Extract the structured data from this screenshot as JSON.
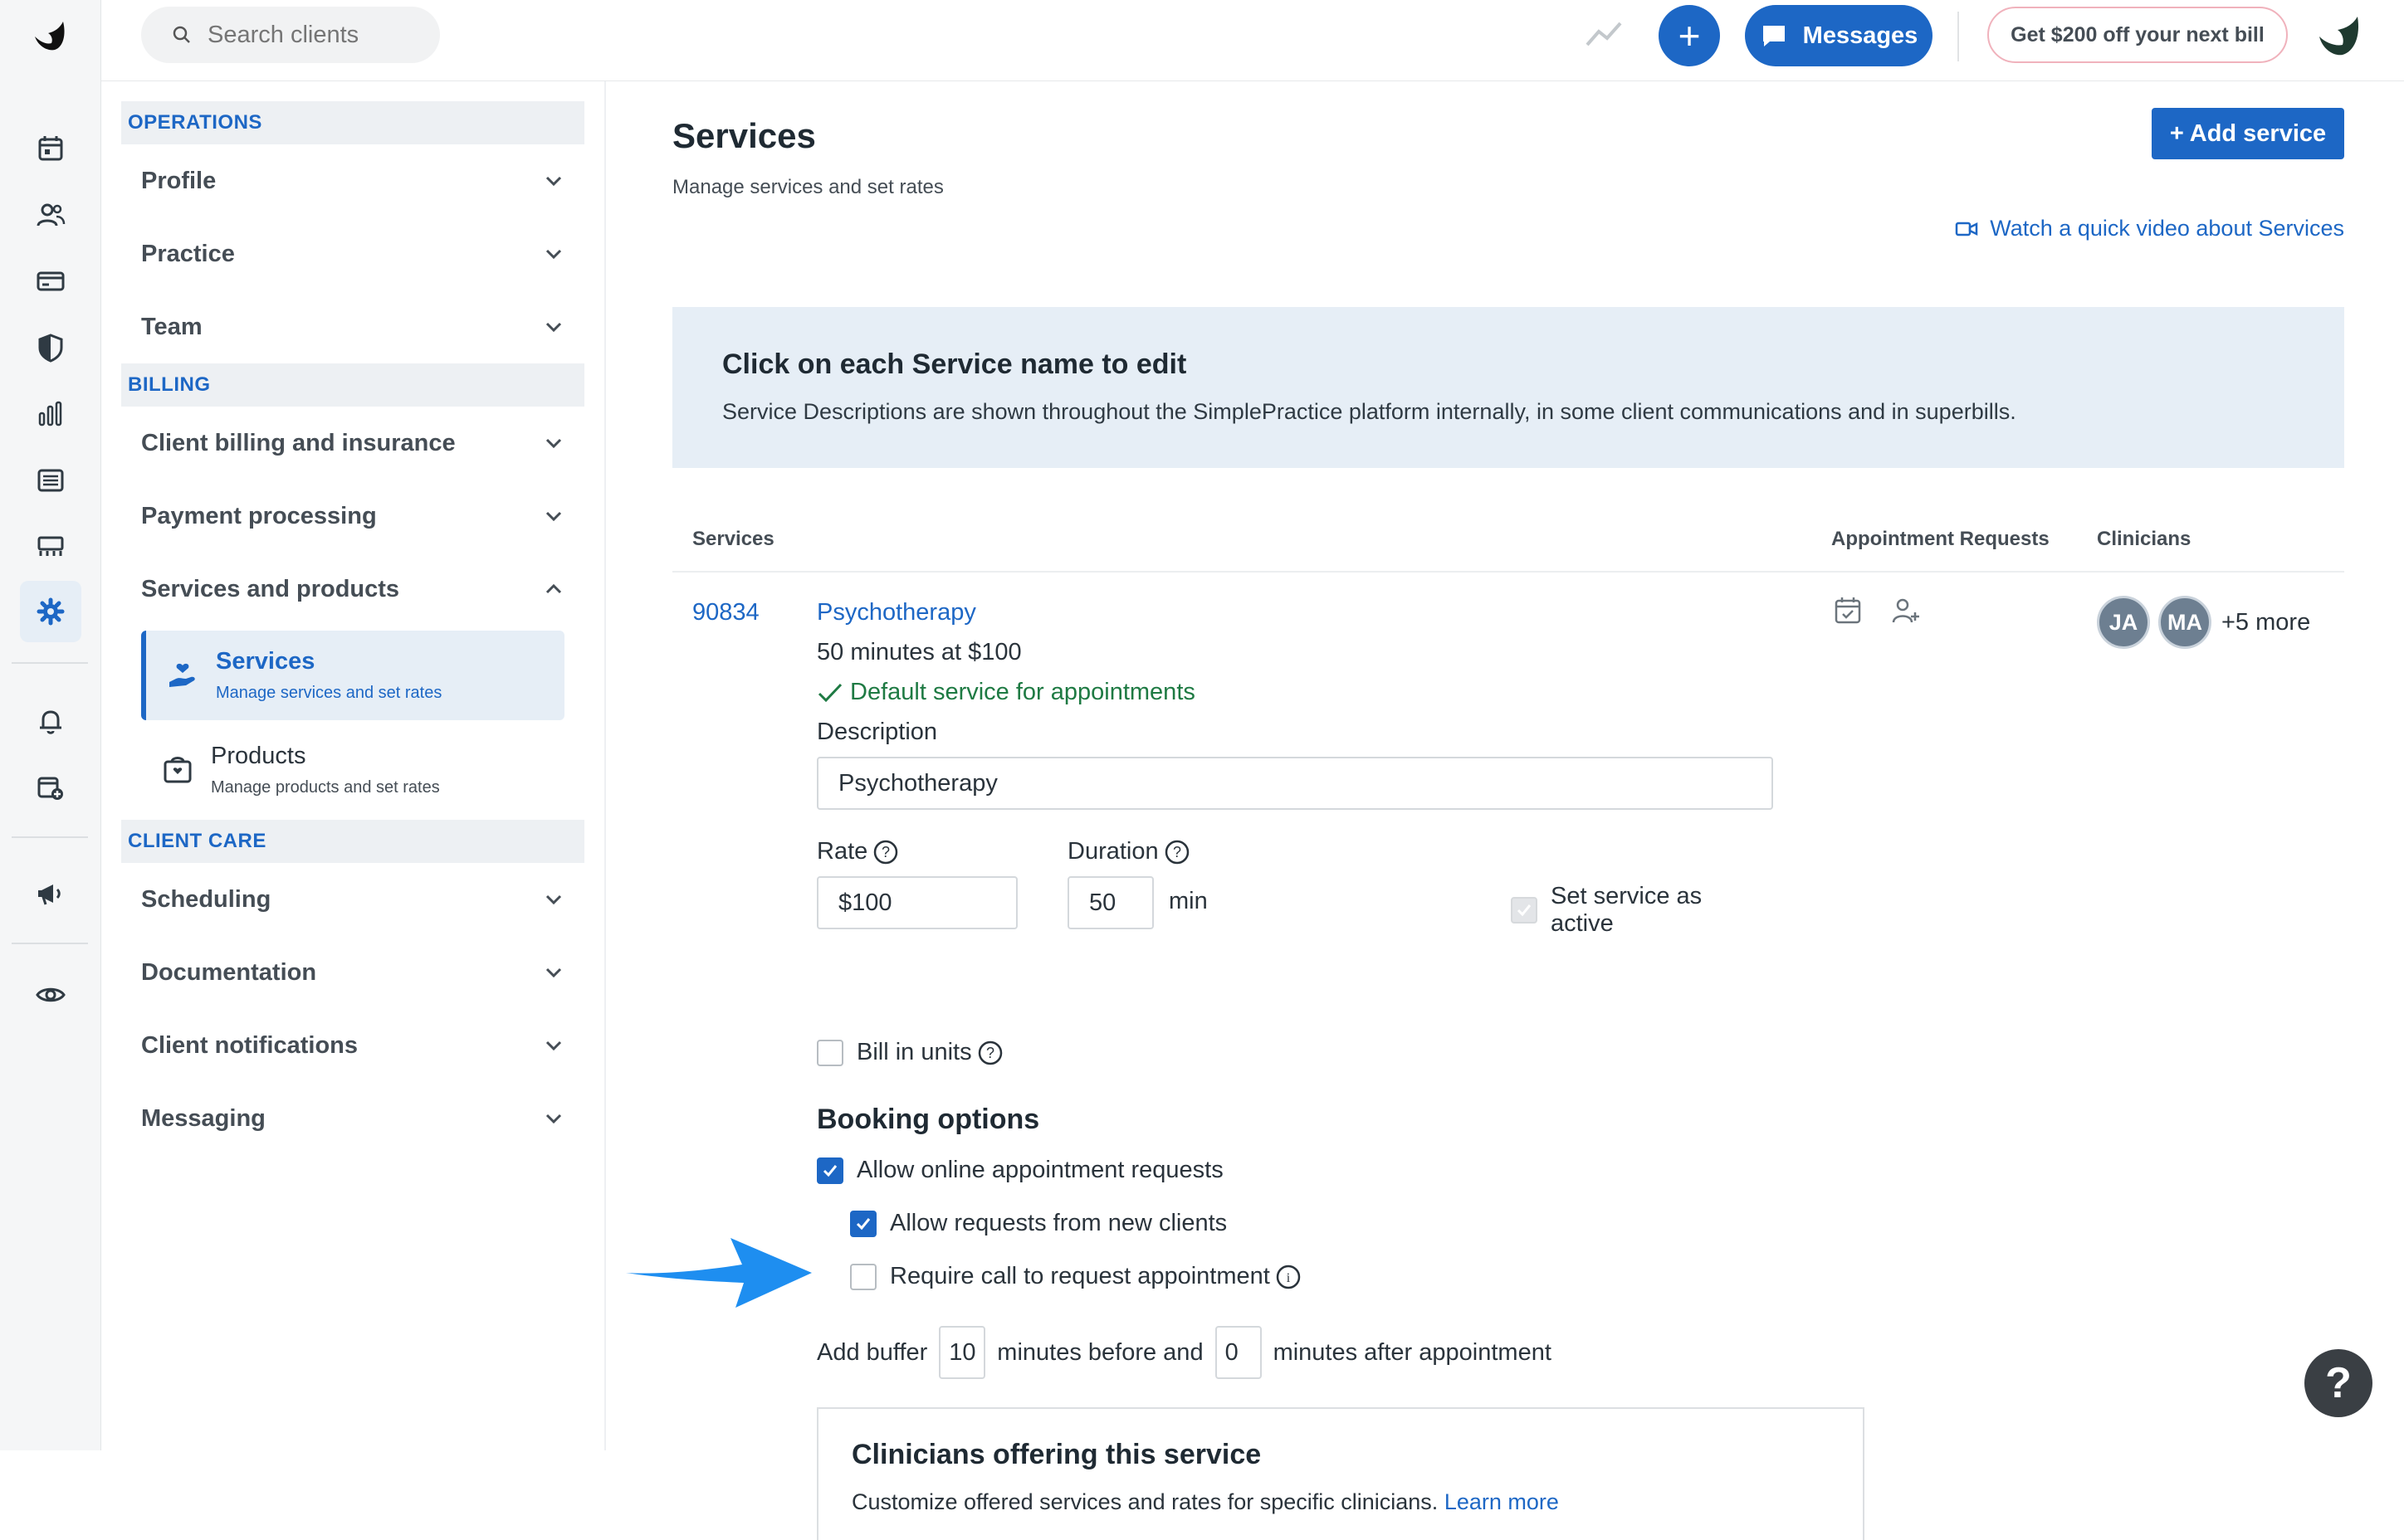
{
  "topbar": {
    "search_placeholder": "Search clients",
    "messages_label": "Messages",
    "promo_label": "Get $200 off your next bill"
  },
  "rail_icons": [
    "calendar-icon",
    "clients-icon",
    "billing-icon",
    "insurance-shield-icon",
    "analytics-icon",
    "documents-icon",
    "marketplace-icon",
    "settings-gear-icon",
    "notifications-bell-icon",
    "requests-calendar-icon",
    "marketing-megaphone-icon",
    "preview-eye-icon"
  ],
  "settings_nav": {
    "operations": {
      "title": "OPERATIONS",
      "items": [
        "Profile",
        "Practice",
        "Team"
      ]
    },
    "billing": {
      "title": "BILLING",
      "items": [
        "Client billing and insurance",
        "Payment processing",
        "Services and products"
      ]
    },
    "sub_items": [
      {
        "title": "Services",
        "subtitle": "Manage services and set rates"
      },
      {
        "title": "Products",
        "subtitle": "Manage products and set rates"
      }
    ],
    "client_care": {
      "title": "CLIENT CARE",
      "items": [
        "Scheduling",
        "Documentation",
        "Client notifications",
        "Messaging"
      ]
    }
  },
  "main": {
    "title": "Services",
    "subtitle": "Manage services and set rates",
    "add_service_label": "+ Add service",
    "video_link": "Watch a quick video about Services",
    "info": {
      "heading": "Click on each Service name to edit",
      "text": "Service Descriptions are shown throughout the SimplePractice platform internally, in some client communications and in superbills."
    },
    "columns": {
      "services": "Services",
      "appointment_requests": "Appointment Requests",
      "clinicians": "Clinicians"
    },
    "service": {
      "code": "90834",
      "name": "Psychotherapy",
      "meta": "50 minutes at $100",
      "default_label": "Default service for appointments",
      "description_label": "Description",
      "description_value": "Psychotherapy",
      "rate_label": "Rate",
      "rate_value": "$100",
      "duration_label": "Duration",
      "duration_value": "50",
      "duration_unit": "min",
      "active_label": "Set service as active",
      "bill_units_label": "Bill in units",
      "booking_heading": "Booking options",
      "allow_online": "Allow online appointment requests",
      "allow_new": "Allow requests from new clients",
      "require_call": "Require call to request appointment",
      "buffer": {
        "prefix": "Add buffer",
        "before_value": "10",
        "middle": "minutes before and",
        "after_value": "0",
        "suffix": "minutes after appointment"
      },
      "clinician_avatars": [
        "JA",
        "MA"
      ],
      "more_label": "+5 more"
    },
    "clinicians_box": {
      "heading": "Clinicians offering this service",
      "text": "Customize offered services and rates for specific clinicians.",
      "link": "Learn more"
    }
  },
  "help_label": "?",
  "colors": {
    "accent": "#1d67c5",
    "success": "#1e7a43",
    "arrow": "#1e8ef0"
  }
}
